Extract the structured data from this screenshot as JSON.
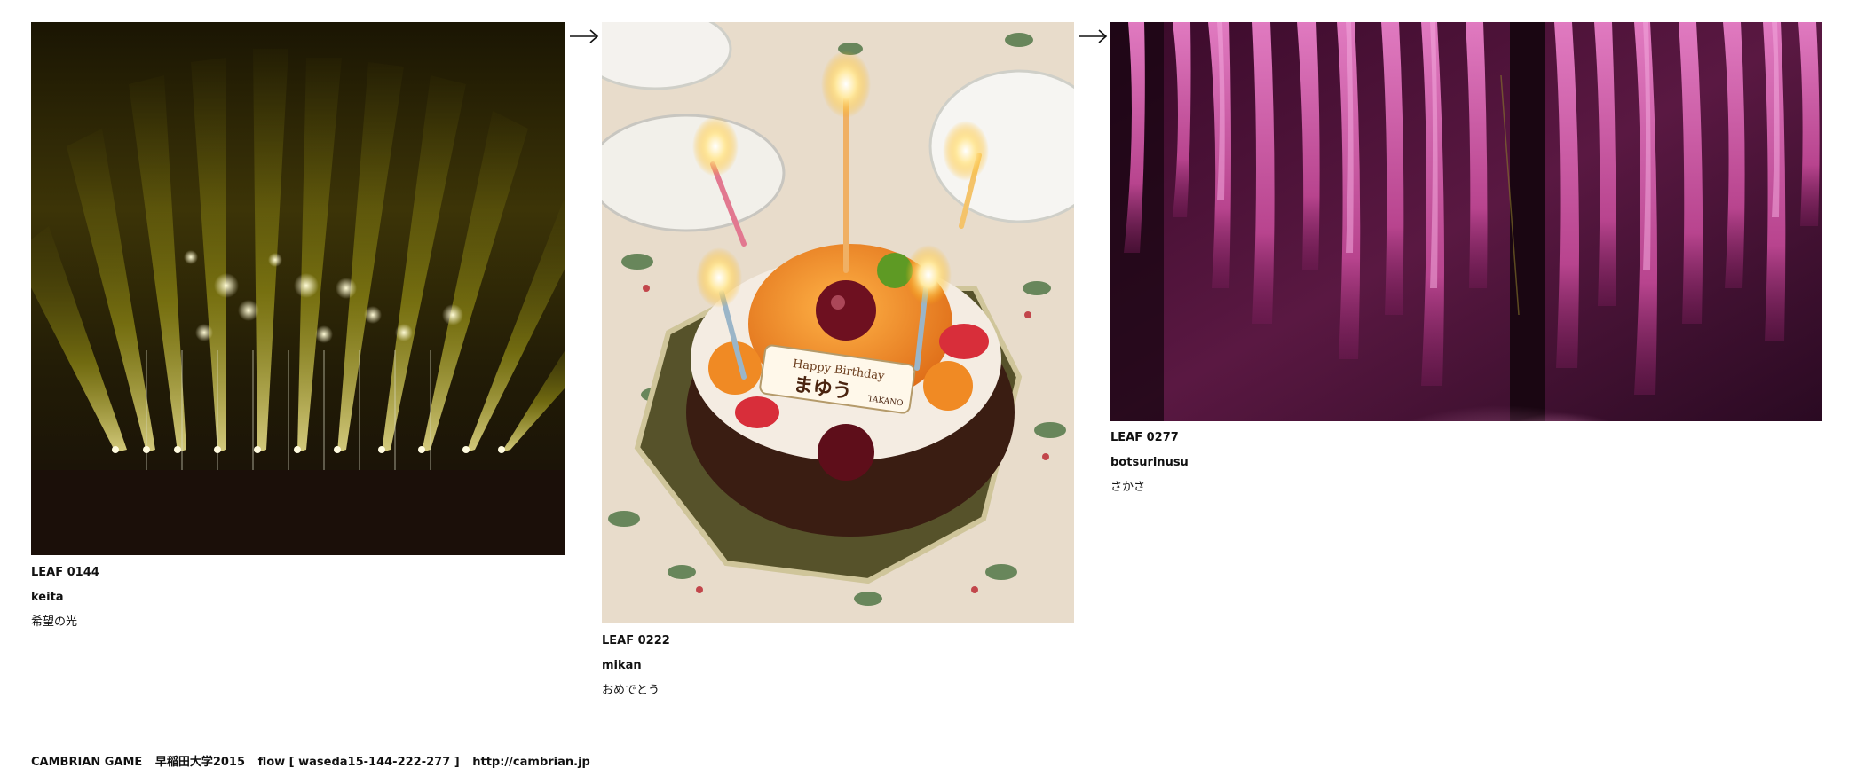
{
  "leaves": [
    {
      "id": "LEAF 0144",
      "author": "keita",
      "title": "希望の光"
    },
    {
      "id": "LEAF 0222",
      "author": "mikan",
      "title": "おめでとう",
      "cake_plaque": {
        "line1": "Happy Birthday",
        "line2": "まゆう",
        "brand": "TAKANO"
      }
    },
    {
      "id": "LEAF 0277",
      "author": "botsurinusu",
      "title": "さかさ"
    }
  ],
  "arrows": [
    "arrow-right-icon",
    "arrow-right-icon"
  ],
  "footer": {
    "project": "CAMBRIAN GAME",
    "school": "早稲田大学2015",
    "flow": "flow [ waseda15-144-222-277 ]",
    "url": "http://cambrian.jp"
  }
}
